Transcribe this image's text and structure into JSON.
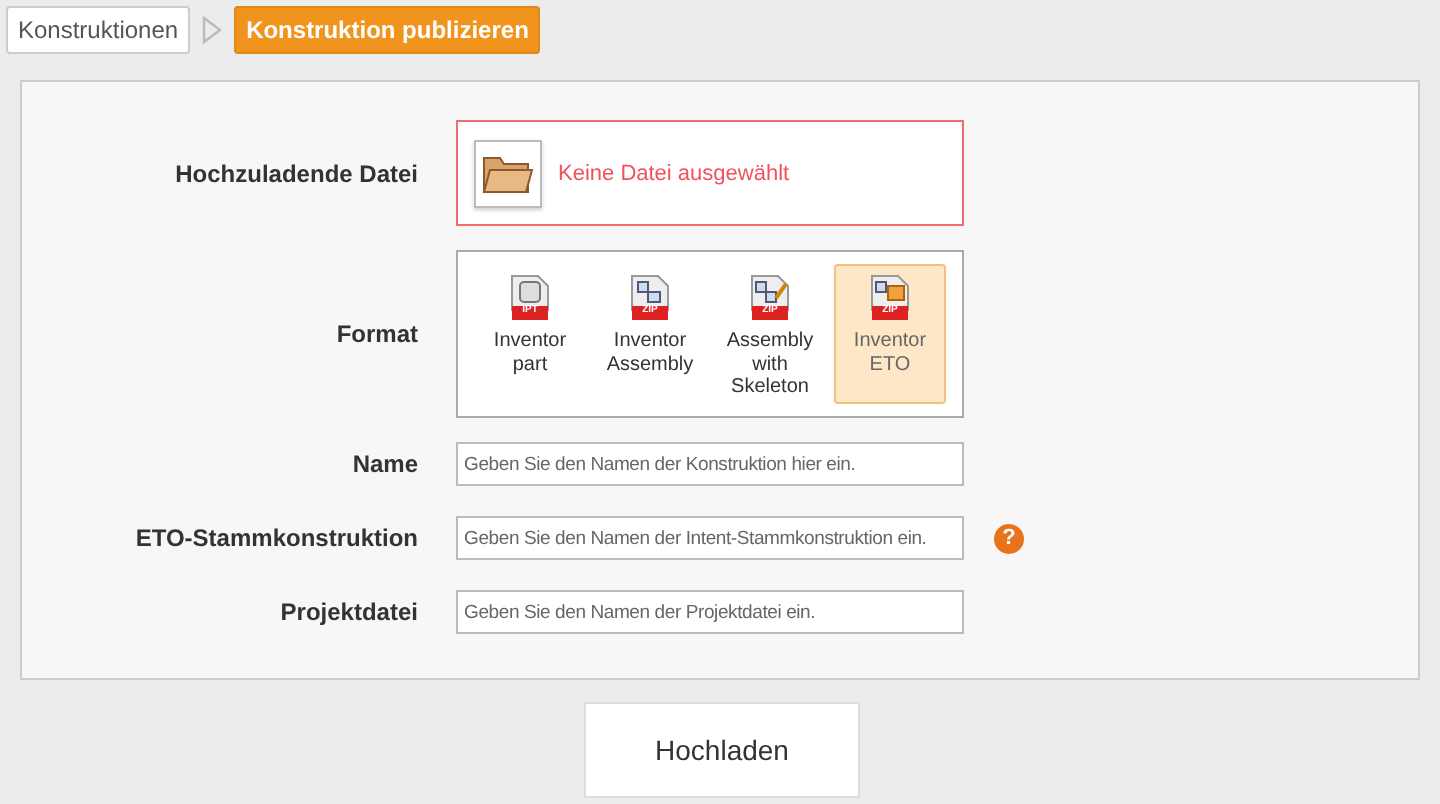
{
  "breadcrumb": [
    {
      "label": "Konstruktionen",
      "selected": false
    },
    {
      "label": "Konstruktion publizieren",
      "selected": true
    }
  ],
  "file": {
    "label": "Hochzuladende Datei",
    "status": "Keine Datei ausgewählt"
  },
  "format": {
    "label": "Format",
    "options": [
      {
        "label": "Inventor part",
        "badge": "IPT",
        "kind": "part",
        "selected": false
      },
      {
        "label": "Inventor Assembly",
        "badge": "ZIP",
        "kind": "assembly",
        "selected": false
      },
      {
        "label": "Assembly with Skeleton",
        "badge": "ZIP",
        "kind": "skeleton",
        "selected": false
      },
      {
        "label": "Inventor ETO",
        "badge": "ZIP",
        "kind": "eto",
        "selected": true
      }
    ]
  },
  "fields": [
    {
      "label": "Name",
      "placeholder": "Geben Sie den Namen der Konstruktion hier ein."
    },
    {
      "label": "ETO-Stammkonstruktion",
      "placeholder": "Geben Sie den Namen der Intent-Stammkonstruktion ein.",
      "help": "?"
    },
    {
      "label": "Projektdatei",
      "placeholder": "Geben Sie den Namen der Projektdatei ein."
    }
  ],
  "upload_button": "Hochladen"
}
